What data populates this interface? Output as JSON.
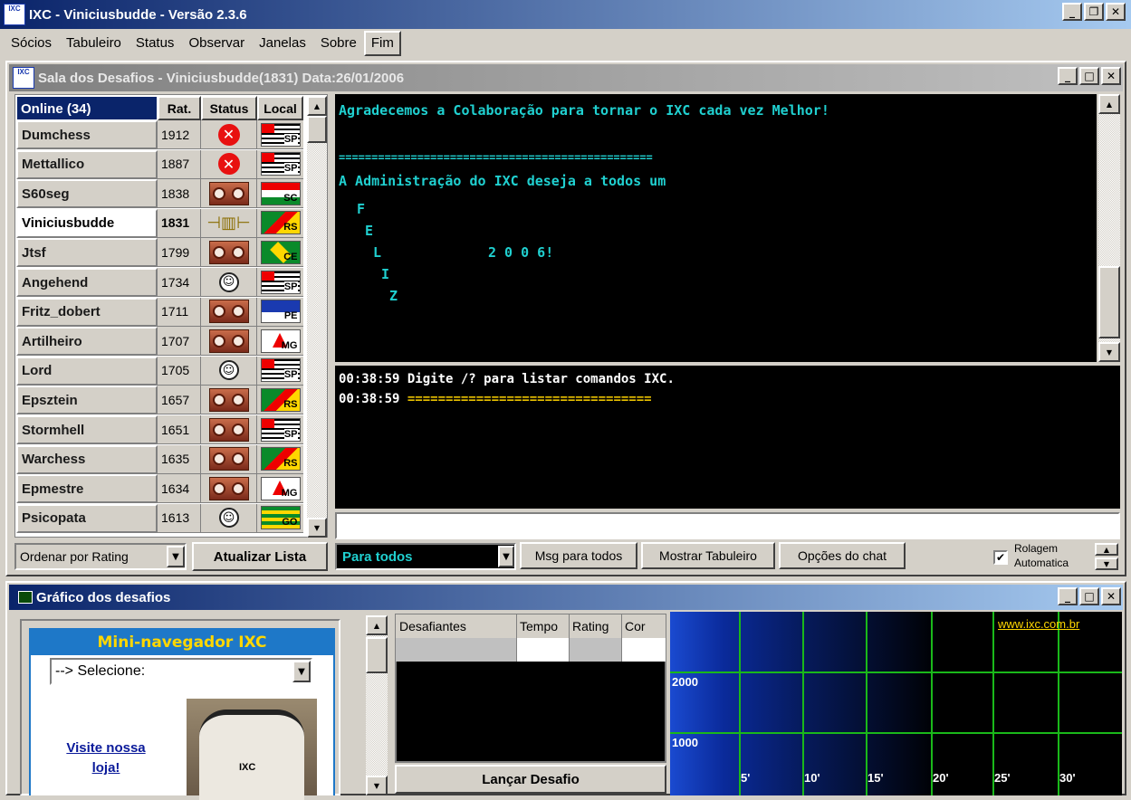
{
  "app": {
    "title": "IXC - Viniciusbudde - Versão 2.3.6",
    "icon": "ixc-logo-icon"
  },
  "menu": [
    "Sócios",
    "Tabuleiro",
    "Status",
    "Observar",
    "Janelas",
    "Sobre",
    "Fim"
  ],
  "window": {
    "title": "Sala dos Desafios - Viniciusbudde(1831)  Data:26/01/2006"
  },
  "players": {
    "headers": {
      "online": "Online (34)",
      "rating": "Rat.",
      "status": "Status",
      "local": "Local"
    },
    "rows": [
      {
        "name": "Dumchess",
        "rating": "1912",
        "status": "declined-x",
        "local": "SP"
      },
      {
        "name": "Mettallico",
        "rating": "1887",
        "status": "declined-x",
        "local": "SP"
      },
      {
        "name": "S60seg",
        "rating": "1838",
        "status": "busy",
        "local": "SC"
      },
      {
        "name": "Viniciusbudde",
        "rating": "1831",
        "status": "plug",
        "local": "RS"
      },
      {
        "name": "Jtsf",
        "rating": "1799",
        "status": "busy",
        "local": "CE"
      },
      {
        "name": "Angehend",
        "rating": "1734",
        "status": "smile",
        "local": "SP"
      },
      {
        "name": "Fritz_dobert",
        "rating": "1711",
        "status": "busy",
        "local": "PE"
      },
      {
        "name": "Artilheiro",
        "rating": "1707",
        "status": "busy",
        "local": "MG"
      },
      {
        "name": "Lord",
        "rating": "1705",
        "status": "smile",
        "local": "SP"
      },
      {
        "name": "Epsztein",
        "rating": "1657",
        "status": "busy",
        "local": "RS"
      },
      {
        "name": "Stormhell",
        "rating": "1651",
        "status": "busy",
        "local": "SP"
      },
      {
        "name": "Warchess",
        "rating": "1635",
        "status": "busy",
        "local": "RS"
      },
      {
        "name": "Epmestre",
        "rating": "1634",
        "status": "busy",
        "local": "MG"
      },
      {
        "name": "Psicopata",
        "rating": "1613",
        "status": "smile",
        "local": "GO"
      }
    ],
    "sort_select": "Ordenar por Rating",
    "refresh_button": "Atualizar Lista"
  },
  "chat": {
    "announce": [
      "Agradecemos a Colaboração para tornar o IXC cada vez Melhor!",
      "",
      "================================================",
      "A Administração do  IXC deseja a todos um"
    ],
    "feliz": {
      "f": "F",
      "e": "E",
      "l": "L",
      "year": "2 0 0 6!",
      "i": "I",
      "z": "Z"
    },
    "log": [
      {
        "time": "00:38:59",
        "text": " Digite /? para listar comandos IXC."
      },
      {
        "time": "00:38:59",
        "text": " ================================"
      }
    ],
    "input_value": "",
    "recipient_select": "Para todos",
    "btn_msg_all": "Msg para todos",
    "btn_show_board": "Mostrar Tabuleiro",
    "btn_chat_options": "Opções do chat",
    "autoscroll_label_1": "Rolagem",
    "autoscroll_label_2": "Automatica",
    "autoscroll_checked": true
  },
  "graph_window": {
    "title": "Gráfico dos desafios"
  },
  "mini_browser": {
    "title": "Mini-navegador IXC",
    "select": "--> Selecione:",
    "link": "Visite nossa loja!",
    "shirt_text": "IXC"
  },
  "challenges": {
    "headers": [
      "Desafiantes",
      "Tempo",
      "Rating",
      "Cor"
    ],
    "launch_button": "Lançar Desafio"
  },
  "graph": {
    "link": "www.ixc.com.br",
    "y_ticks": [
      "2000",
      "1000"
    ],
    "x_ticks": [
      "5'",
      "10'",
      "15'",
      "20'",
      "25'",
      "30'"
    ]
  },
  "colors": {
    "title_active": "#0a246a",
    "chat_cyan": "#20d0d0",
    "chat_yellow": "#e8c000",
    "grid_green": "#1ab81a"
  }
}
